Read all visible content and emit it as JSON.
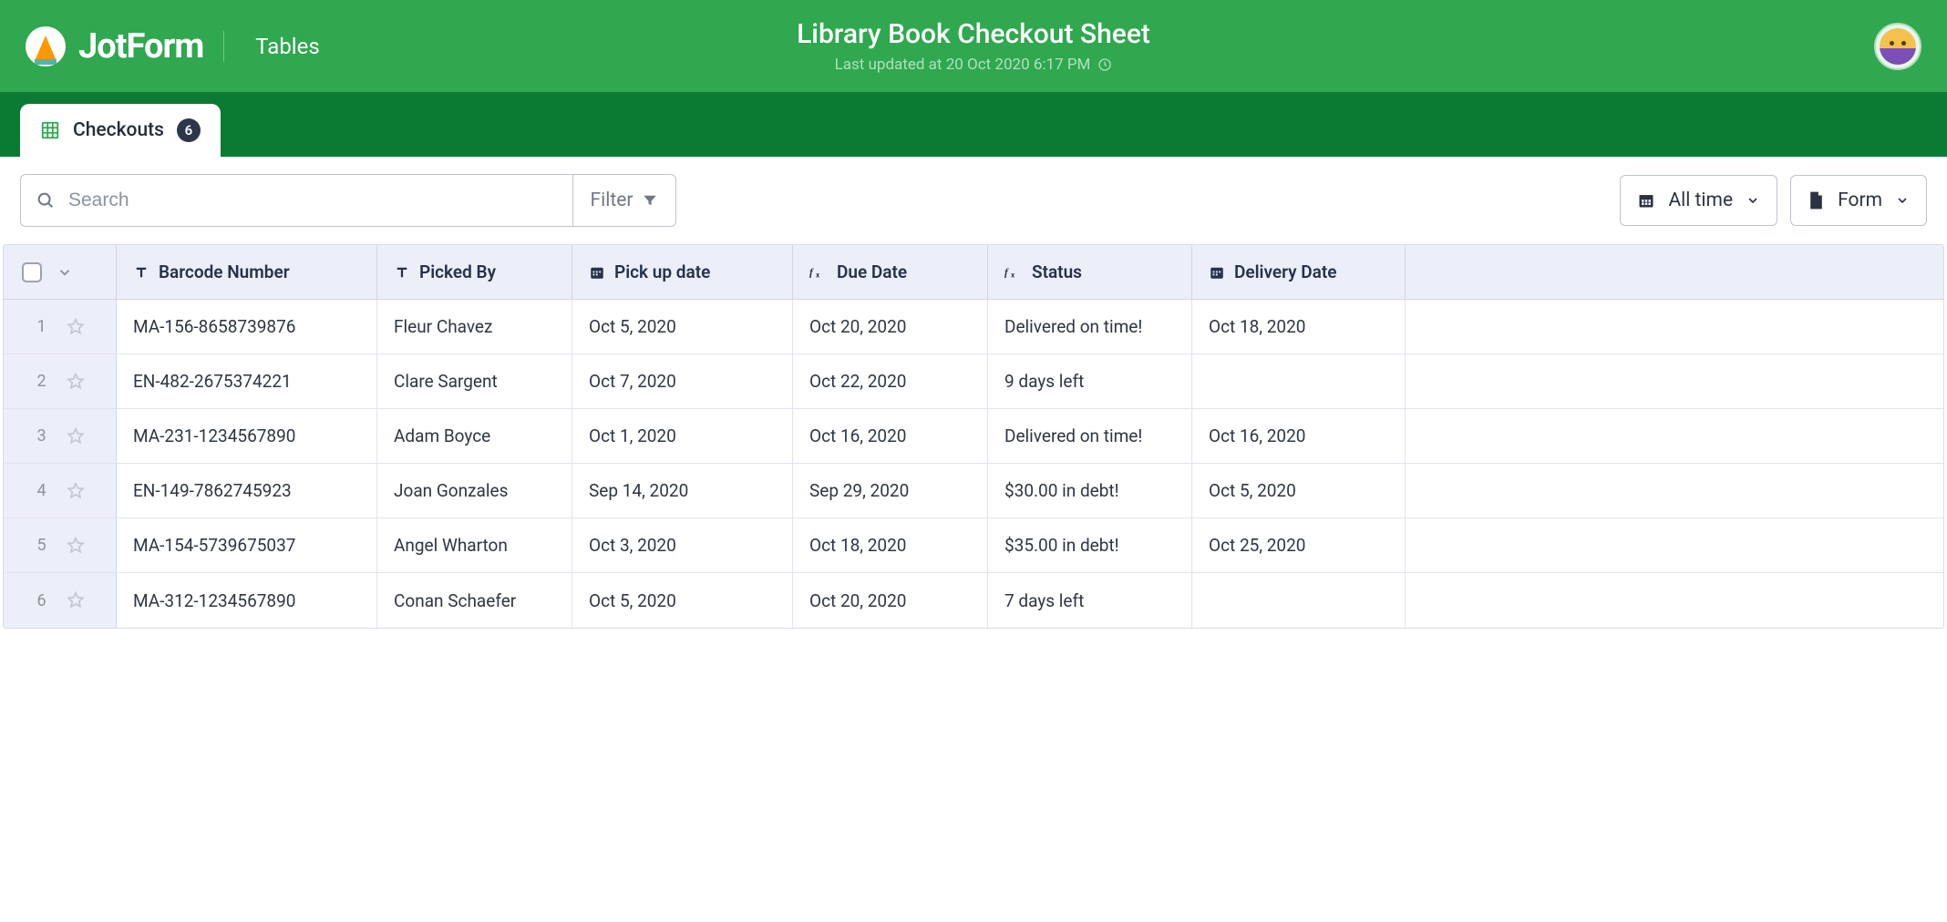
{
  "brand": "JotForm",
  "product": "Tables",
  "page": {
    "title": "Library Book Checkout Sheet",
    "subtitle": "Last updated at 20 Oct 2020 6:17 PM"
  },
  "tab": {
    "label": "Checkouts",
    "count": "6"
  },
  "search": {
    "placeholder": "Search"
  },
  "filter": {
    "label": "Filter"
  },
  "timeRange": {
    "label": "All time"
  },
  "formMenu": {
    "label": "Form"
  },
  "columns": {
    "barcode": "Barcode Number",
    "pickedBy": "Picked By",
    "pickup": "Pick up date",
    "due": "Due Date",
    "status": "Status",
    "delivery": "Delivery Date"
  },
  "rows": [
    {
      "num": "1",
      "barcode": "MA-156-8658739876",
      "pickedBy": "Fleur Chavez",
      "pickup": "Oct 5, 2020",
      "due": "Oct 20, 2020",
      "status": "Delivered on time!",
      "delivery": "Oct 18, 2020"
    },
    {
      "num": "2",
      "barcode": "EN-482-2675374221",
      "pickedBy": "Clare Sargent",
      "pickup": "Oct 7, 2020",
      "due": "Oct 22, 2020",
      "status": "9 days left",
      "delivery": ""
    },
    {
      "num": "3",
      "barcode": "MA-231-1234567890",
      "pickedBy": "Adam Boyce",
      "pickup": "Oct 1, 2020",
      "due": "Oct 16, 2020",
      "status": "Delivered on time!",
      "delivery": "Oct 16, 2020"
    },
    {
      "num": "4",
      "barcode": "EN-149-7862745923",
      "pickedBy": "Joan Gonzales",
      "pickup": "Sep 14, 2020",
      "due": "Sep 29, 2020",
      "status": "$30.00 in debt!",
      "delivery": "Oct 5, 2020"
    },
    {
      "num": "5",
      "barcode": "MA-154-5739675037",
      "pickedBy": "Angel Wharton",
      "pickup": "Oct 3, 2020",
      "due": "Oct 18, 2020",
      "status": "$35.00 in debt!",
      "delivery": "Oct 25, 2020"
    },
    {
      "num": "6",
      "barcode": "MA-312-1234567890",
      "pickedBy": "Conan Schaefer",
      "pickup": "Oct 5, 2020",
      "due": "Oct 20, 2020",
      "status": "7 days left",
      "delivery": ""
    }
  ]
}
